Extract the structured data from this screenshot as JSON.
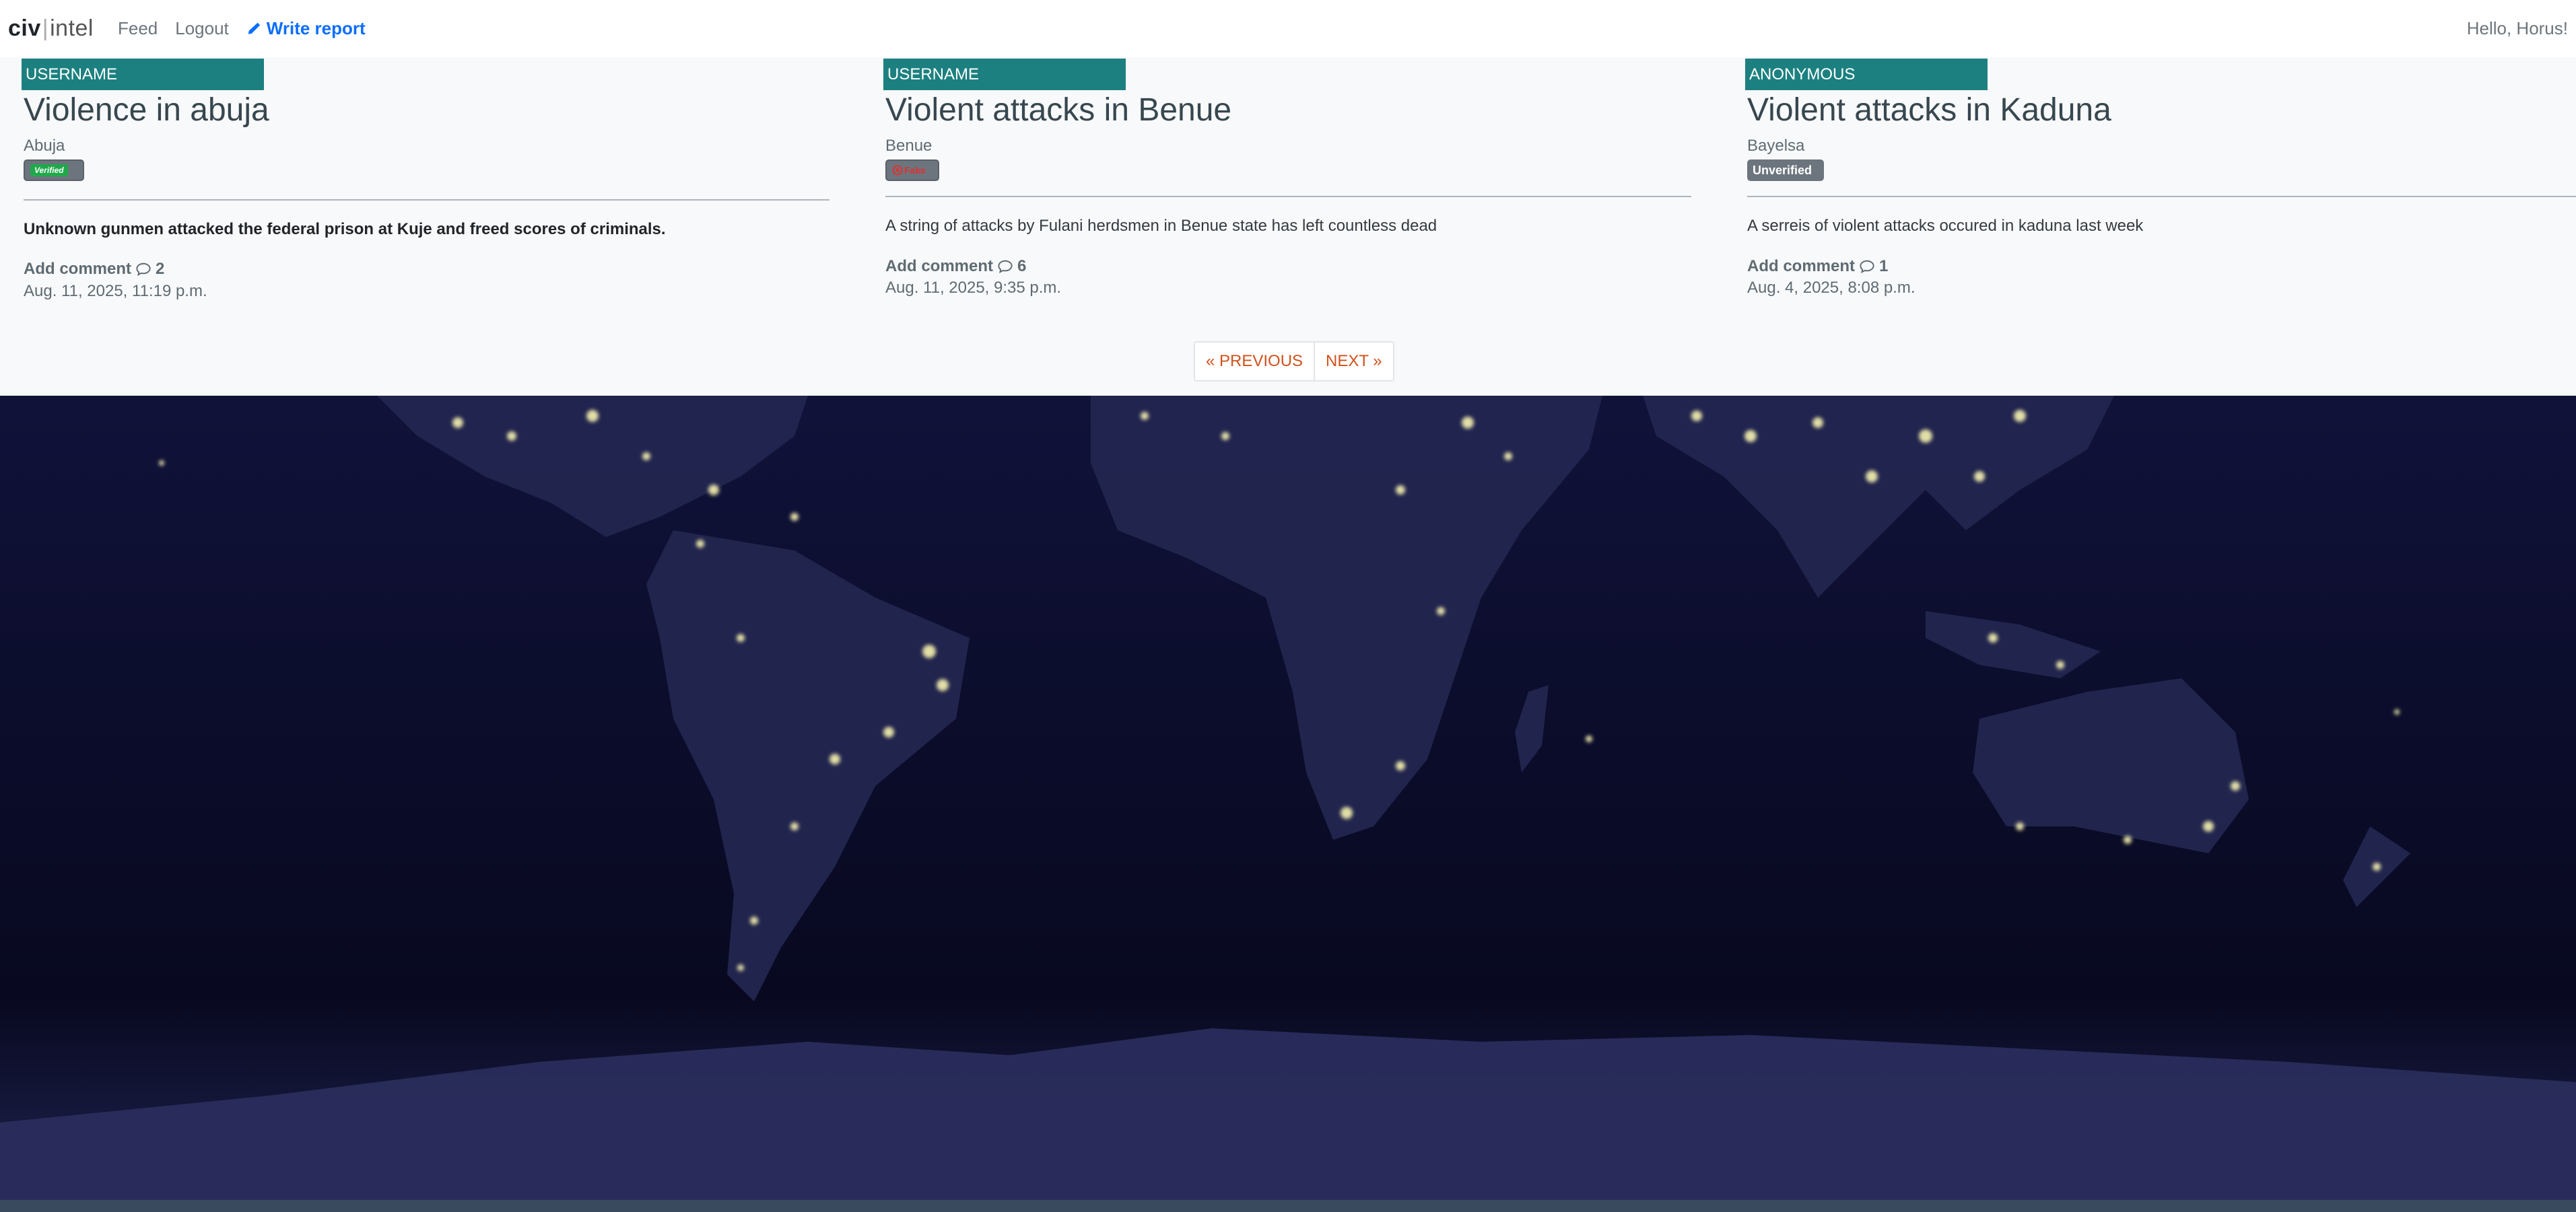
{
  "navbar": {
    "brand_civ": "civ",
    "brand_sep": "|",
    "brand_intel": "intel",
    "feed_label": "Feed",
    "logout_label": "Logout",
    "write_report_label": "Write report",
    "greeting": "Hello, Horus!"
  },
  "reports": [
    {
      "username": "USERNAME",
      "title": "Violence in abuja",
      "location": "Abuja",
      "badge": "Verified",
      "body": "Unknown gunmen attacked the federal prison at Kuje and freed scores of criminals.",
      "comment_label": "Add comment",
      "comment_count": "2",
      "date": "Aug. 11, 2025, 11:19 p.m."
    },
    {
      "username": "USERNAME",
      "title": "Violent attacks in Benue",
      "location": "Benue",
      "badge": "Fake",
      "body": "A string of attacks by Fulani herdsmen in Benue state has left countless dead",
      "comment_label": "Add comment",
      "comment_count": "6",
      "date": "Aug. 11, 2025, 9:35 p.m."
    },
    {
      "username": "ANONYMOUS",
      "title": "Violent attacks in Kaduna",
      "location": "Bayelsa",
      "badge": "Unverified",
      "body": "A serreis of violent attacks occured in kaduna last week",
      "comment_label": "Add comment",
      "comment_count": "1",
      "date": "Aug. 4, 2025, 8:08 p.m."
    }
  ],
  "pagination": {
    "previous_label": "« PREVIOUS",
    "next_label": "NEXT »"
  },
  "colors": {
    "accent_teal": "#1d8080",
    "link_blue": "#0d6efd",
    "pagination_orange": "#d0511b"
  },
  "icons": {
    "pencil": "pencil-icon",
    "comment": "speech-bubble-icon",
    "fake": "x-circle-icon"
  }
}
